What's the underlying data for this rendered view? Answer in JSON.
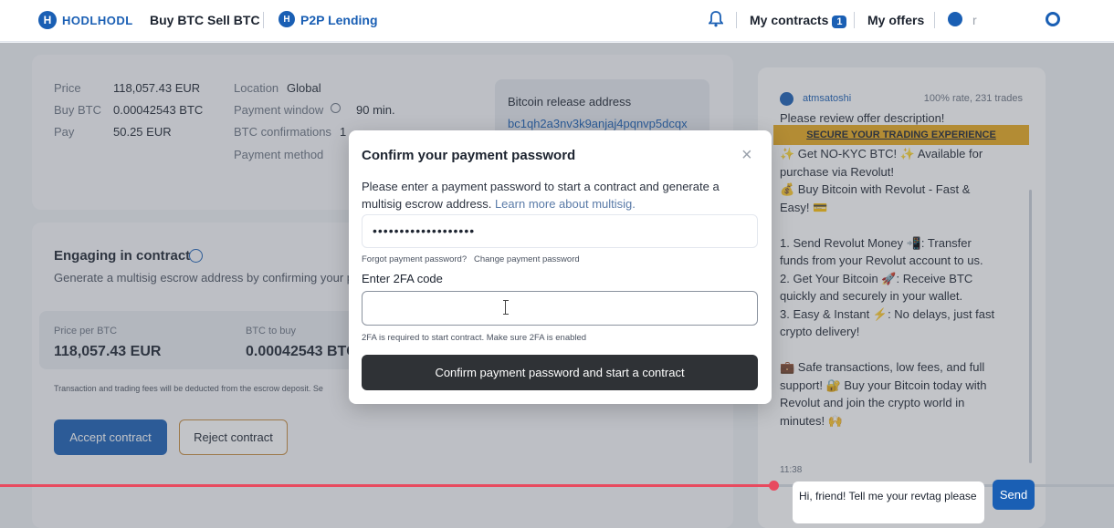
{
  "header": {
    "logo_text": "HODLHODL",
    "nav": {
      "buy": "Buy BTC",
      "sell": "Sell BTC",
      "lending": "P2P Lending"
    },
    "my_contracts": "My contracts",
    "contracts_count": "1",
    "my_offers": "My offers",
    "user_name": "r"
  },
  "offer": {
    "price_label": "Price",
    "price_value": "118,057.43 EUR",
    "buy_label": "Buy BTC",
    "buy_value": "0.00042543 BTC",
    "pay_label": "Pay",
    "pay_value": "50.25 EUR",
    "location_label": "Location",
    "location_value": "Global",
    "window_label": "Payment window",
    "window_value": "90 min.",
    "confirmations_label": "BTC confirmations",
    "confirmations_value": "1",
    "method_label": "Payment method"
  },
  "release": {
    "title": "Bitcoin release address",
    "address": "bc1qh2a3nv3k9anjaj4pqnvp5dcqx"
  },
  "contract": {
    "title": "Engaging in contract",
    "subtitle": "Generate a multisig escrow address by confirming your p",
    "price_per_btc_label": "Price per BTC",
    "price_per_btc_value": "118,057.43 EUR",
    "btc_to_buy_label": "BTC to buy",
    "btc_to_buy_value": "0.00042543 BTC",
    "fees_note": "Transaction and trading fees will be deducted from the escrow deposit. Se",
    "accept_label": "Accept contract",
    "reject_label": "Reject contract"
  },
  "chat": {
    "name": "atmsatoshi",
    "rate": "100% rate, 231 trades",
    "promo": "SECURE YOUR TRADING EXPERIENCE",
    "top_line": "Please review offer description!",
    "message": "✨ Get NO-KYC BTC! ✨ Available for purchase via Revolut!\n💰 Buy Bitcoin with Revolut - Fast & Easy! 💳\n\n1. Send Revolut Money 📲: Transfer funds from your Revolut account to us.\n2. Get Your Bitcoin 🚀: Receive BTC quickly and securely in your wallet.\n3. Easy & Instant ⚡: No delays, just fast crypto delivery!\n\n💼 Safe transactions, low fees, and full support! 🔐 Buy your Bitcoin today with Revolut and join the crypto world in minutes! 🙌",
    "time": "11:38",
    "input_value": "Hi, friend! Tell me your revtag please",
    "send_label": "Send"
  },
  "modal": {
    "title": "Confirm your payment password",
    "close": "×",
    "desc": "Please enter a payment password to start a contract and generate a multisig escrow address.",
    "learn_more": "Learn more about multisig.",
    "password_value": "•••••••••••••••••••",
    "forgot": "Forgot payment password?",
    "change": "Change payment password",
    "twofa_label": "Enter 2FA code",
    "twofa_hint": "2FA is required to start contract. Make sure 2FA is enabled",
    "confirm_label": "Confirm payment password and start a contract"
  },
  "colors": {
    "brand": "#1a5fb4",
    "promo": "#e8a91c",
    "progress": "#e84a5f",
    "confirm": "#2f3236"
  }
}
